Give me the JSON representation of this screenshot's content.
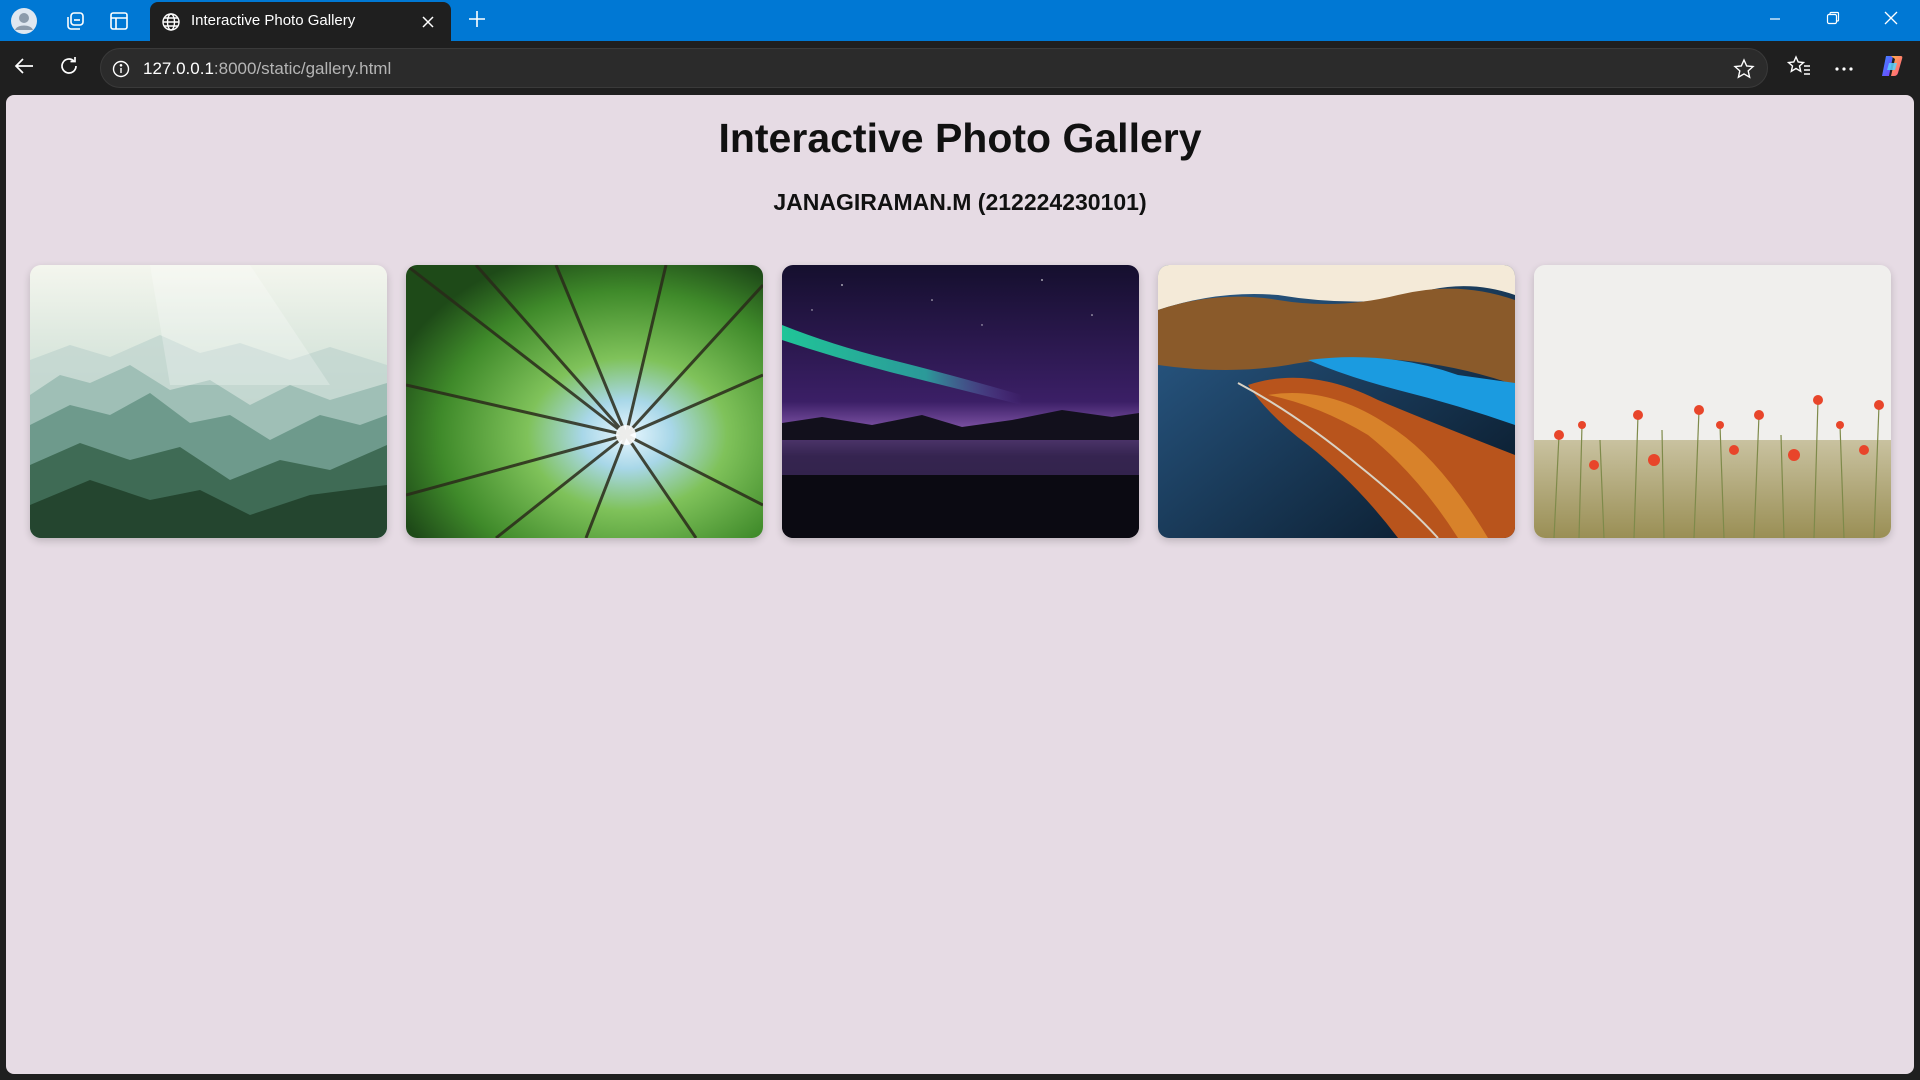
{
  "browser": {
    "tab_title": "Interactive Photo Gallery",
    "url_host": "127.0.0.1",
    "url_rest": ":8000/static/gallery.html",
    "accent_color": "#0078d4",
    "icons": [
      "profile-icon",
      "workspaces-icon",
      "tab-actions-icon",
      "globe-icon",
      "close-icon",
      "plus-icon",
      "minimize-icon",
      "restore-icon",
      "window-close-icon",
      "back-arrow-icon",
      "refresh-icon",
      "info-icon",
      "star-icon",
      "favorites-icon",
      "more-icon",
      "copilot-icon"
    ]
  },
  "page": {
    "title": "Interactive Photo Gallery",
    "subtitle": "JANAGIRAMAN.M (212224230101)",
    "background_color": "#e6dbe4",
    "photos": [
      {
        "subject": "misty mountain valley"
      },
      {
        "subject": "forest canopy looking up"
      },
      {
        "subject": "aurora over lake at night"
      },
      {
        "subject": "autumn forest and lake aerial view"
      },
      {
        "subject": "red poppies in wheat field"
      }
    ]
  }
}
